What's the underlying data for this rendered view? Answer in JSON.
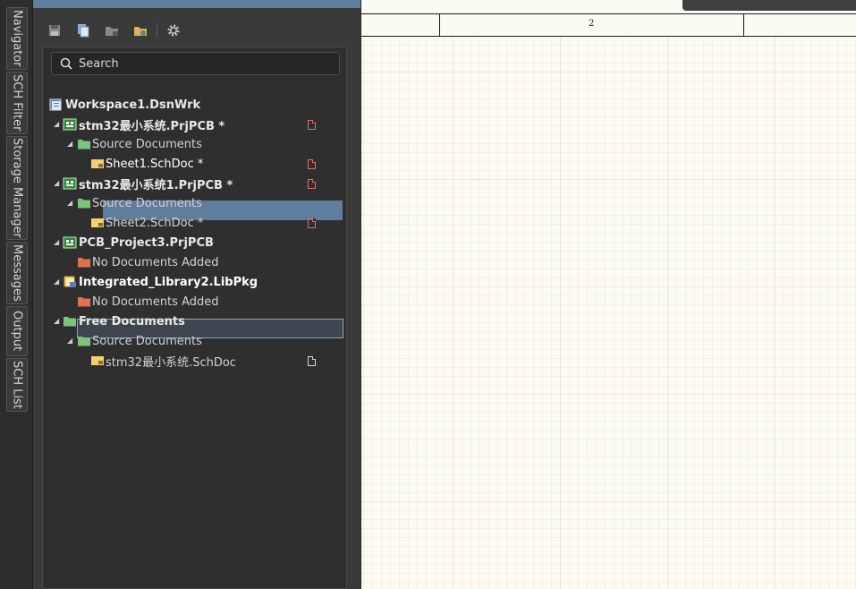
{
  "side_tabs": [
    "Navigator",
    "SCH Filter",
    "Storage Manager",
    "Messages",
    "Output",
    "SCH List"
  ],
  "search": {
    "placeholder": "Search"
  },
  "tree": {
    "workspace": "Workspace1.DsnWrk",
    "project1": {
      "label": "stm32最小系统.PrjPCB *",
      "folder": "Source Documents",
      "doc": "Sheet1.SchDoc *"
    },
    "project2": {
      "label": "stm32最小系统1.PrjPCB *",
      "folder": "Source Documents",
      "doc": "Sheet2.SchDoc *"
    },
    "project3": {
      "label": "PCB_Project3.PrjPCB",
      "empty": "No Documents Added"
    },
    "library": {
      "label": "Integrated_Library2.LibPkg",
      "empty": "No Documents Added"
    },
    "free": {
      "label": "Free Documents",
      "folder": "Source Documents",
      "doc": "stm32最小系统.SchDoc"
    }
  },
  "ruler": {
    "zone": "2"
  },
  "colors": {
    "selection": "#5f7d9c",
    "folder_green": "#7cc47c",
    "folder_red": "#e07050",
    "doc_yellow": "#f0d070"
  }
}
